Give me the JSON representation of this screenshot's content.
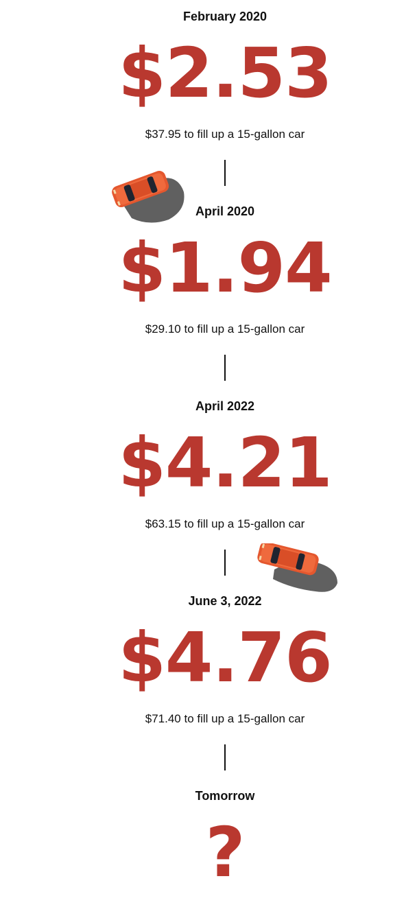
{
  "timeline": [
    {
      "date": "February 2020",
      "price": "$2.53",
      "fill_text": "$37.95 to fill up a 15-gallon car"
    },
    {
      "date": "April 2020",
      "price": "$1.94",
      "fill_text": "$29.10 to fill up a 15-gallon car"
    },
    {
      "date": "April 2022",
      "price": "$4.21",
      "fill_text": "$63.15 to fill up a 15-gallon car"
    },
    {
      "date": "June 3, 2022",
      "price": "$4.76",
      "fill_text": "$71.40 to fill up a 15-gallon car"
    },
    {
      "date": "Tomorrow",
      "price": "?"
    }
  ],
  "colors": {
    "price": "#b9382f",
    "car_body": "#e4572e",
    "text": "#111111"
  },
  "icons": [
    "car-icon",
    "car-icon"
  ]
}
